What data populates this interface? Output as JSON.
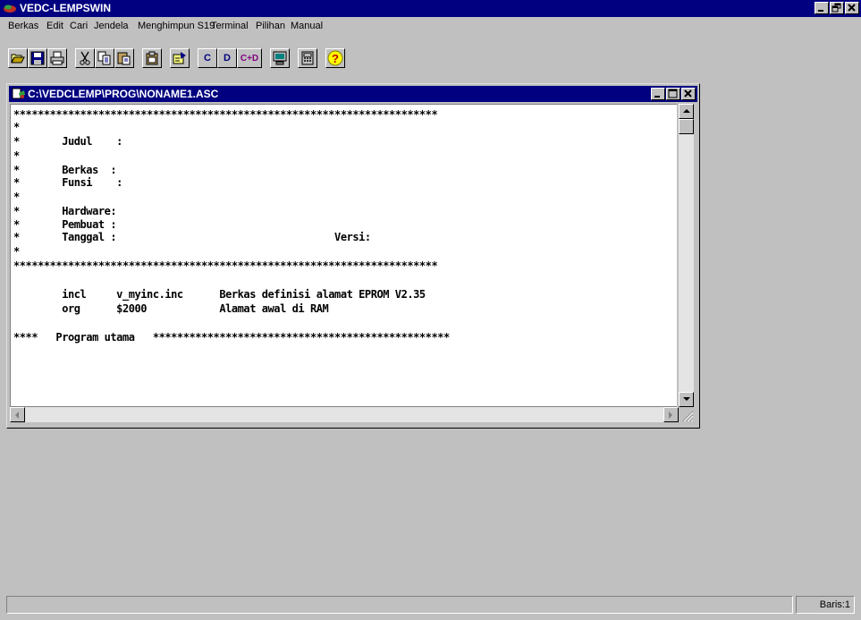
{
  "app": {
    "title": "VEDC-LEMPSWIN",
    "colors": {
      "titlebar": "#000080",
      "face": "#c0c0c0",
      "editor_bg": "#ffffff"
    }
  },
  "menu": {
    "items": [
      "Berkas",
      "Edit",
      "Cari",
      "Jendela",
      "Menghimpun S19",
      "Terminal",
      "Pilihan",
      "Manual"
    ]
  },
  "toolbar": {
    "buttons": [
      {
        "name": "open-icon"
      },
      {
        "name": "save-icon"
      },
      {
        "name": "print-icon"
      },
      {
        "name": "cut-icon"
      },
      {
        "name": "copy-icon"
      },
      {
        "name": "paste-icon"
      },
      {
        "name": "clipboard-icon"
      },
      {
        "name": "run-icon"
      },
      {
        "name": "compile-c",
        "label": "C"
      },
      {
        "name": "download-d",
        "label": "D"
      },
      {
        "name": "compile-download-cd",
        "label": "C+D"
      },
      {
        "name": "monitor-icon"
      },
      {
        "name": "calculator-icon"
      },
      {
        "name": "help-icon",
        "label": "?"
      }
    ]
  },
  "document": {
    "title": "C:\\VEDCLEMP\\PROG\\NONAME1.ASC",
    "lines": [
      "**********************************************************************",
      "*",
      "*       Judul    :",
      "*",
      "*       Berkas  :",
      "*       Funsi    :",
      "*",
      "*       Hardware:",
      "*       Pembuat :",
      "*       Tanggal :                                    Versi:",
      "*",
      "**********************************************************************",
      "",
      "        incl     v_myinc.inc      Berkas definisi alamat EPROM V2.35",
      "        org      $2000            Alamat awal di RAM",
      "",
      "****   Program utama   *************************************************"
    ]
  },
  "status": {
    "message": "",
    "line": "Baris:1"
  }
}
